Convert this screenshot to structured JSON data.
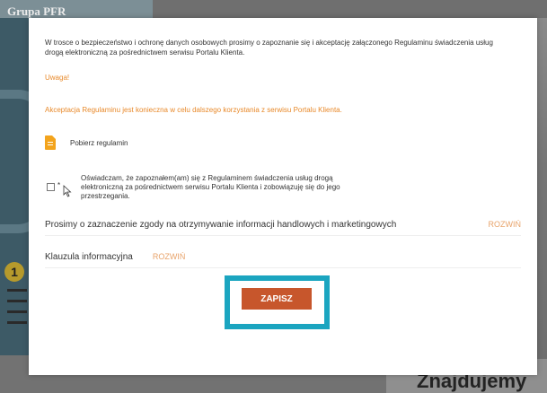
{
  "header": {
    "brand": "Grupa PFR"
  },
  "modal": {
    "intro_text": "W trosce o bezpieczeństwo i ochronę danych osobowych prosimy o zapoznanie się i akceptację załączonego Regulaminu świadczenia usług drogą elektroniczną za pośrednictwem serwisu Portalu Klienta.",
    "warning": "Uwaga!",
    "required_notice": "Akceptacja Regulaminu jest konieczna w celu dalszego korzystania z serwisu Portalu Klienta.",
    "download_label": "Pobierz regulamin",
    "consent": {
      "asterisk": "*",
      "text": "Oświadczam, że zapoznałem(am) się z Regulaminem świadczenia usług drogą elektroniczną za pośrednictwem serwisu Portalu Klienta i zobowiązuję się do jego przestrzegania.",
      "checked": false
    },
    "marketing": {
      "label": "Prosimy o zaznaczenie zgody na otrzymywanie informacji handlowych i marketingowych",
      "expand": "ROZWIŃ"
    },
    "clause": {
      "label": "Klauzula informacyjna",
      "expand": "ROZWIŃ"
    },
    "save_label": "ZAPISZ"
  },
  "background": {
    "headline": "Znajdujemy",
    "badge_number": "1"
  },
  "colors": {
    "accent_orange": "#e8892a",
    "button": "#c7562c",
    "highlight": "#1ba5c0"
  },
  "icons": [
    "document-icon",
    "checkbox-icon",
    "cursor-icon"
  ]
}
